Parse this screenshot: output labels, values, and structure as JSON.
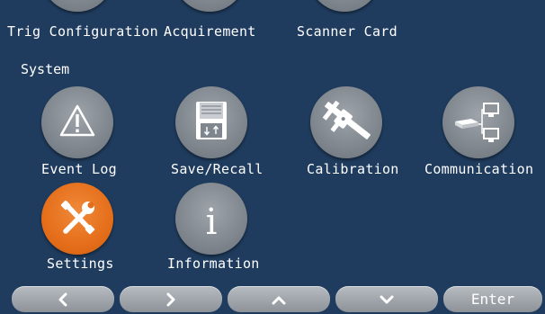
{
  "top_row": {
    "items": [
      {
        "label": "Trig Configuration",
        "icon": "trigger-icon"
      },
      {
        "label": "Acquirement",
        "icon": "acquire-icon"
      },
      {
        "label": "Scanner Card",
        "icon": "scanner-card-icon"
      }
    ]
  },
  "system": {
    "title": "System",
    "items": [
      {
        "label": "Event Log",
        "icon": "warning-icon"
      },
      {
        "label": "Save/Recall",
        "icon": "floppy-disk-icon"
      },
      {
        "label": "Calibration",
        "icon": "caliper-icon"
      },
      {
        "label": "Communication",
        "icon": "network-icon"
      },
      {
        "label": "Settings",
        "icon": "wrench-screwdriver-icon",
        "selected": true
      },
      {
        "label": "Information",
        "icon": "info-icon"
      }
    ]
  },
  "nav": {
    "left": "chevron-left-icon",
    "right": "chevron-right-icon",
    "up": "chevron-up-icon",
    "down": "chevron-down-icon",
    "enter_label": "Enter"
  },
  "colors": {
    "background": "#1f3c5e",
    "button_gray": "#8c9298",
    "selected_orange": "#e56e1a"
  }
}
